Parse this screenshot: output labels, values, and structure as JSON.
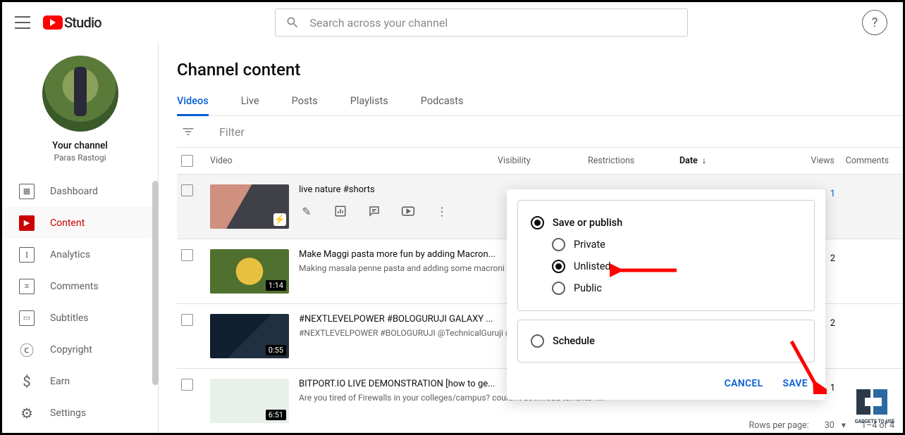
{
  "header": {
    "logo_text": "Studio",
    "search_placeholder": "Search across your channel",
    "help": "?"
  },
  "sidebar": {
    "channel_label": "Your channel",
    "channel_name": "Paras Rastogi",
    "items": [
      {
        "label": "Dashboard",
        "icon": "▦"
      },
      {
        "label": "Content",
        "icon": "▶"
      },
      {
        "label": "Analytics",
        "icon": "⫾"
      },
      {
        "label": "Comments",
        "icon": "≡"
      },
      {
        "label": "Subtitles",
        "icon": "▭"
      },
      {
        "label": "Copyright",
        "icon": "ⓒ"
      },
      {
        "label": "Earn",
        "icon": "$"
      },
      {
        "label": "Settings",
        "icon": "⚙"
      }
    ]
  },
  "page": {
    "title": "Channel content",
    "tabs": [
      "Videos",
      "Live",
      "Posts",
      "Playlists",
      "Podcasts"
    ],
    "filter_placeholder": "Filter",
    "columns": {
      "video": "Video",
      "visibility": "Visibility",
      "restrictions": "Restrictions",
      "date": "Date",
      "views": "Views",
      "comments": "Comments"
    }
  },
  "rows": [
    {
      "title": "live nature #shorts",
      "desc": "",
      "duration": "",
      "shorts": true,
      "views": "1"
    },
    {
      "title": "Make Maggi pasta more fun by adding Macron...",
      "desc": "Making masala penne pasta and adding some macroni to it to increase its quantity and adding...",
      "duration": "1:14",
      "views": "2"
    },
    {
      "title": "#NEXTLEVELPOWER #BOLOGURUJI GALAXY ...",
      "desc": "#NEXTLEVELPOWER #BOLOGURUJI @TechnicalGuruji @TechnicalGuruji My...",
      "duration": "0:55",
      "views": "2"
    },
    {
      "title": "BITPORT.IO LIVE DEMONSTRATION [how to ge...",
      "desc": "Are you tired of Firewalls in your colleges/campus? couldn't download torrents ?...",
      "duration": "6:51",
      "views": "1"
    }
  ],
  "popover": {
    "save_publish": "Save or publish",
    "private": "Private",
    "unlisted": "Unlisted",
    "public": "Public",
    "schedule": "Schedule",
    "cancel": "CANCEL",
    "save": "SAVE"
  },
  "pager": {
    "rows_label": "Rows per page:",
    "rows_value": "30",
    "range": "1–4 of 4"
  }
}
